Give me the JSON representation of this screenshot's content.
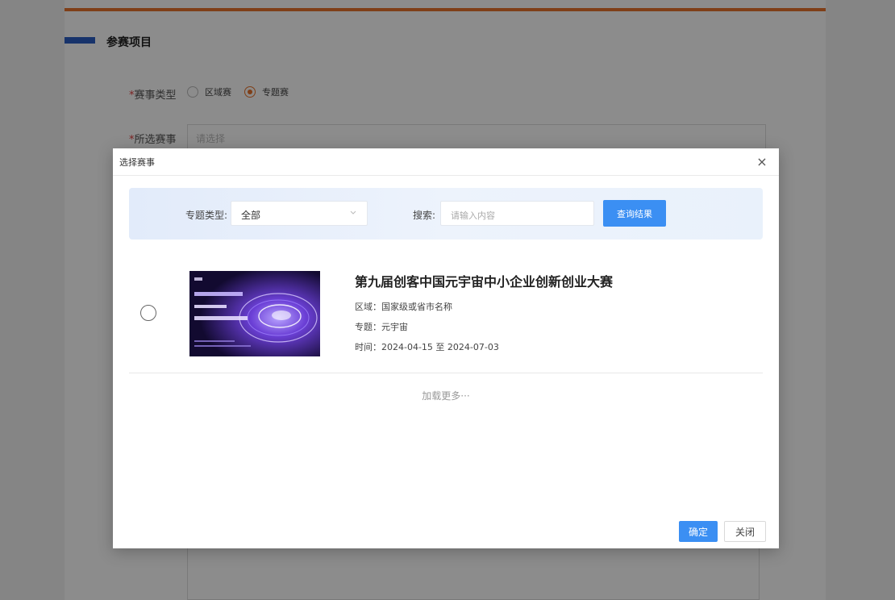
{
  "page": {
    "section_title": "参赛项目",
    "event_type": {
      "required_mark": "*",
      "label": "赛事类型",
      "options": [
        "区域赛",
        "专题赛"
      ],
      "selected": "专题赛"
    },
    "selected_event": {
      "required_mark": "*",
      "label": "所选赛事",
      "placeholder": "请选择"
    }
  },
  "dialog": {
    "title": "选择赛事",
    "close_symbol": "×",
    "filters": {
      "topic_type_label": "专题类型:",
      "topic_type_value": "全部",
      "search_label": "搜索:",
      "search_placeholder": "请输入内容",
      "query_button": "查询结果"
    },
    "results": [
      {
        "title": "第九届创客中国元宇宙中小企业创新创业大赛",
        "region": "区域：国家级或省市名称",
        "topic": "专题：元宇宙",
        "time": "时间：2024-04-15 至 2024-07-03"
      }
    ],
    "load_more": "加载更多···",
    "confirm_button": "确定",
    "close_button": "关闭"
  },
  "colors": {
    "accent_orange": "#e8732c",
    "section_blue": "#2a5ec4",
    "primary_button": "#3b8ff3"
  }
}
